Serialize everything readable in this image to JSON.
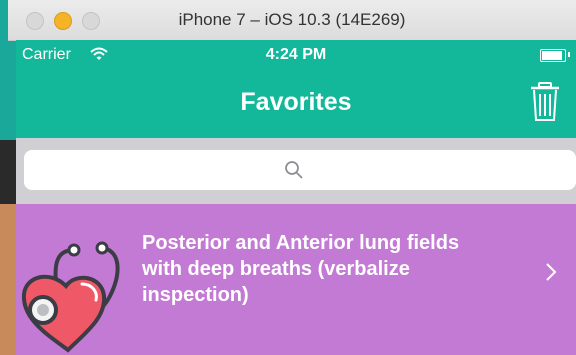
{
  "window": {
    "title": "iPhone 7 – iOS 10.3 (14E269)"
  },
  "status_bar": {
    "carrier": "Carrier",
    "time": "4:24 PM",
    "battery_level": 1.0
  },
  "nav_bar": {
    "title": "Favorites",
    "trash_icon": "trash-icon"
  },
  "search": {
    "placeholder": "",
    "icon": "search-icon"
  },
  "favorites": [
    {
      "text": "Posterior and Anterior lung fields with deep breaths (verbalize inspection)",
      "icon": "heart-stethoscope-icon"
    }
  ],
  "colors": {
    "primary": "#13b89a",
    "row_bg": "#c37ad4",
    "search_bg": "#cfcfd4"
  }
}
